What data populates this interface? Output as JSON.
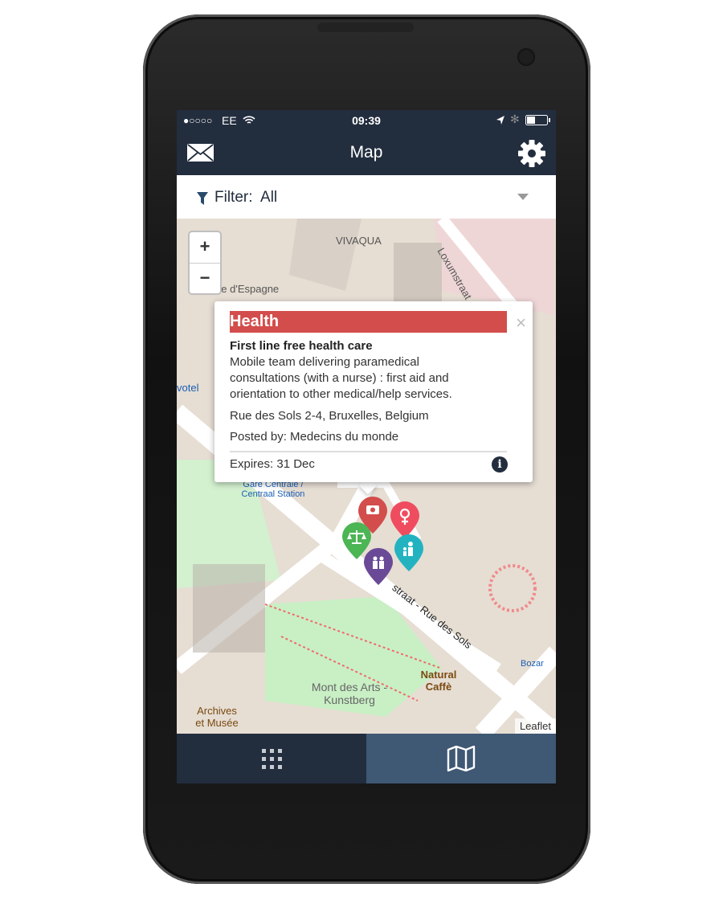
{
  "status_bar": {
    "signal": "●○○○○",
    "carrier": "EE",
    "time": "09:39"
  },
  "header": {
    "title": "Map",
    "left_icon": "envelope-icon",
    "right_icon": "gear-icon"
  },
  "filter": {
    "label": "Filter:",
    "value": "All"
  },
  "map": {
    "zoom_in": "+",
    "zoom_out": "−",
    "labels": {
      "vivaqua": "VIVAQUA",
      "loxum": "Loxumstraat",
      "espagne": "Place d'Espagne",
      "hotel": "votel",
      "gare": "Gare Centrale / Centraal Station",
      "street": "straat - Rue des Sols",
      "natural": "Natural Caffè",
      "mont": "Mont des Arts - Kunstberg",
      "archives": "Archives et Musée",
      "bozar": "Bozar"
    },
    "attribution": "Leaflet",
    "markers": [
      {
        "category": "health",
        "icon": "first-aid-kit-icon",
        "color": "#d24d4b"
      },
      {
        "category": "women",
        "icon": "female-symbol-icon",
        "color": "#ef4d5f"
      },
      {
        "category": "legal",
        "icon": "scales-icon",
        "color": "#4cb554"
      },
      {
        "category": "family",
        "icon": "family-icon",
        "color": "#23b3c0"
      },
      {
        "category": "toilets",
        "icon": "toilets-icon",
        "color": "#6a4a97"
      }
    ]
  },
  "popup": {
    "category": "Health",
    "category_color": "#d24d4b",
    "title": "First line free health care",
    "description": "Mobile team delivering paramedical consultations (with a nurse) : first aid and orientation to other medical/help services.",
    "address": "Rue des Sols 2-4, Bruxelles, Belgium",
    "posted_by": "Posted by: Medecins du monde",
    "expires": "Expires: 31 Dec",
    "close": "×",
    "info": "i"
  },
  "tabs": [
    {
      "icon": "grid-icon",
      "active": false
    },
    {
      "icon": "map-icon",
      "active": true
    }
  ]
}
